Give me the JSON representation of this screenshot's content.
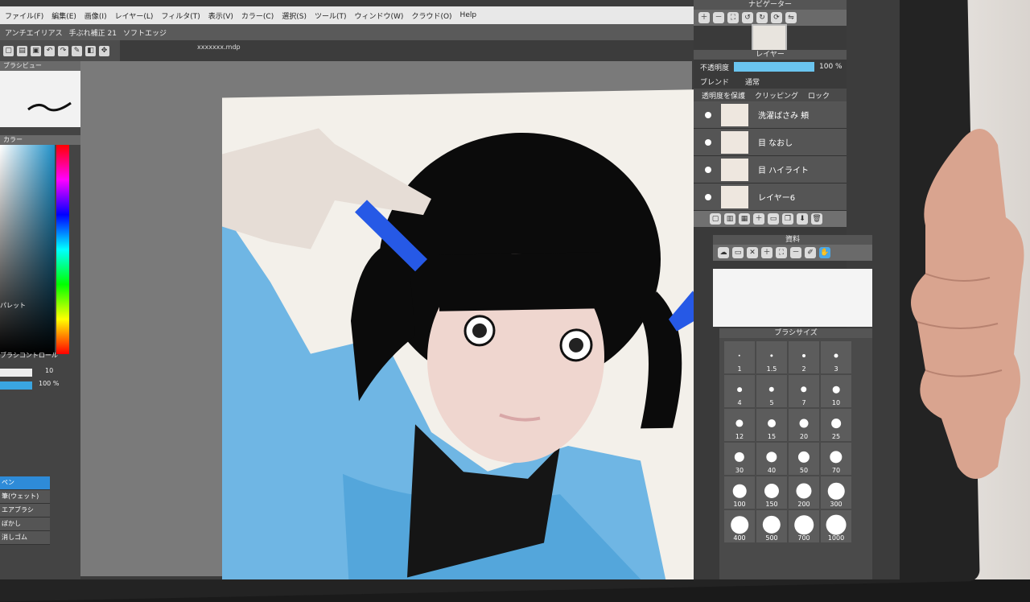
{
  "menu": [
    "ファイル(F)",
    "編集(E)",
    "画像(I)",
    "レイヤー(L)",
    "フィルタ(T)",
    "表示(V)",
    "カラー(C)",
    "選択(S)",
    "ツール(T)",
    "ウィンドウ(W)",
    "クラウド(O)",
    "Help"
  ],
  "options": {
    "antialias": "アンチエイリアス",
    "stabilizer": "手ぶれ補正 21",
    "soft_edge": "ソフトエッジ"
  },
  "filename": "xxxxxxx.mdp",
  "left_panels": {
    "brush_preview_title": "ブラシビュー",
    "color_title": "カラー",
    "palette_title": "パレット",
    "brush_control_title": "ブラシコントロール",
    "brush_size_value": "10",
    "opacity_value": "100 %",
    "tools": [
      "ペン",
      "筆(ウェット)",
      "エアブラシ",
      "ぼかし",
      "消しゴム"
    ]
  },
  "navigator": {
    "title": "ナビゲーター"
  },
  "layers_panel": {
    "title": "レイヤー",
    "opacity_label": "不透明度",
    "opacity_value": "100 %",
    "opacity_fraction": 1.0,
    "blend_label": "ブレンド",
    "blend_value": "通常",
    "protect_label": "透明度を保護",
    "clipping_label": "クリッピング",
    "lock_label": "ロック",
    "layers": [
      {
        "name": "洗濯ばさみ 頬"
      },
      {
        "name": "目 なおし"
      },
      {
        "name": "目 ハイライト"
      },
      {
        "name": "レイヤー6"
      }
    ]
  },
  "materials_panel": {
    "title": "資料"
  },
  "brush_size_panel": {
    "title": "ブラシサイズ",
    "sizes": [
      "1",
      "1.5",
      "2",
      "3",
      "4",
      "5",
      "7",
      "10",
      "12",
      "15",
      "20",
      "25",
      "30",
      "40",
      "50",
      "70",
      "100",
      "150",
      "200",
      "300",
      "400",
      "500",
      "700",
      "1000"
    ]
  }
}
